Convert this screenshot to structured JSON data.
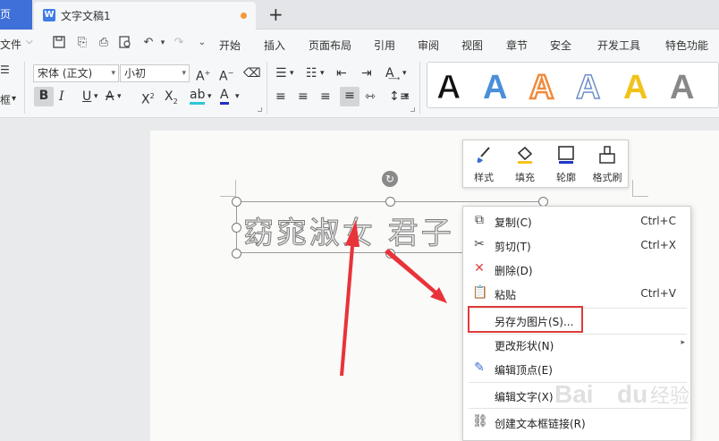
{
  "tabs": {
    "home_label": "页",
    "doc_title": "文字文稿1",
    "add_tab": "+"
  },
  "menu": {
    "file_label": "文件",
    "items": [
      "开始",
      "插入",
      "页面布局",
      "引用",
      "审阅",
      "视图",
      "章节",
      "安全",
      "开发工具",
      "特色功能"
    ]
  },
  "ribbon": {
    "frame_label": "框",
    "font_name": "宋体 (正文)",
    "font_size": "小初",
    "wordart_styles": [
      {
        "color": "#111111",
        "fill": "#111111"
      },
      {
        "color": "#4a8fd8",
        "fill": "#4a8fd8"
      },
      {
        "color": "#f08a3c",
        "fill": "outline"
      },
      {
        "color": "#6f8fc8",
        "fill": "outline"
      },
      {
        "color": "#f3c21a",
        "fill": "#f3c21a"
      },
      {
        "color": "#777777",
        "fill": "#777777"
      }
    ]
  },
  "document": {
    "wordart_text": "窈窕淑女 君子"
  },
  "mini_toolbar": {
    "buttons": [
      "样式",
      "填充",
      "轮廓",
      "格式刷"
    ]
  },
  "context_menu": {
    "copy": {
      "label": "复制(C)",
      "shortcut": "Ctrl+C"
    },
    "cut": {
      "label": "剪切(T)",
      "shortcut": "Ctrl+X"
    },
    "delete": {
      "label": "删除(D)"
    },
    "paste": {
      "label": "粘贴",
      "shortcut": "Ctrl+V"
    },
    "save_as_image": {
      "label": "另存为图片(S)..."
    },
    "change_shape": {
      "label": "更改形状(N)"
    },
    "edit_points": {
      "label": "编辑顶点(E)"
    },
    "edit_text": {
      "label": "编辑文字(X)"
    },
    "create_link": {
      "label": "创建文本框链接(R)"
    }
  },
  "watermark": {
    "brand": "Bai",
    "brand2": "经验"
  },
  "colors": {
    "accent": "#3f6fd8",
    "annotation_red": "#e03a3a",
    "arrow_red": "#e8333a"
  }
}
